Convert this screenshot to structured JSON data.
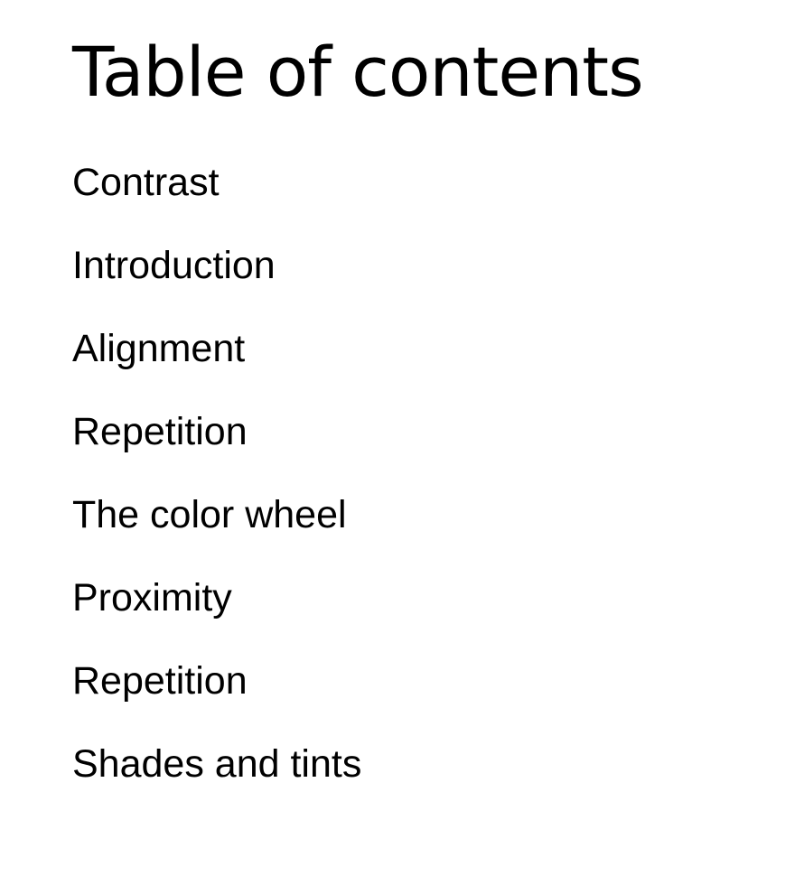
{
  "toc": {
    "title": "Table of contents",
    "items": [
      {
        "label": "Contrast"
      },
      {
        "label": "Introduction"
      },
      {
        "label": "Alignment"
      },
      {
        "label": "Repetition"
      },
      {
        "label": "The color wheel"
      },
      {
        "label": "Proximity"
      },
      {
        "label": "Repetition"
      },
      {
        "label": "Shades and tints"
      }
    ]
  }
}
